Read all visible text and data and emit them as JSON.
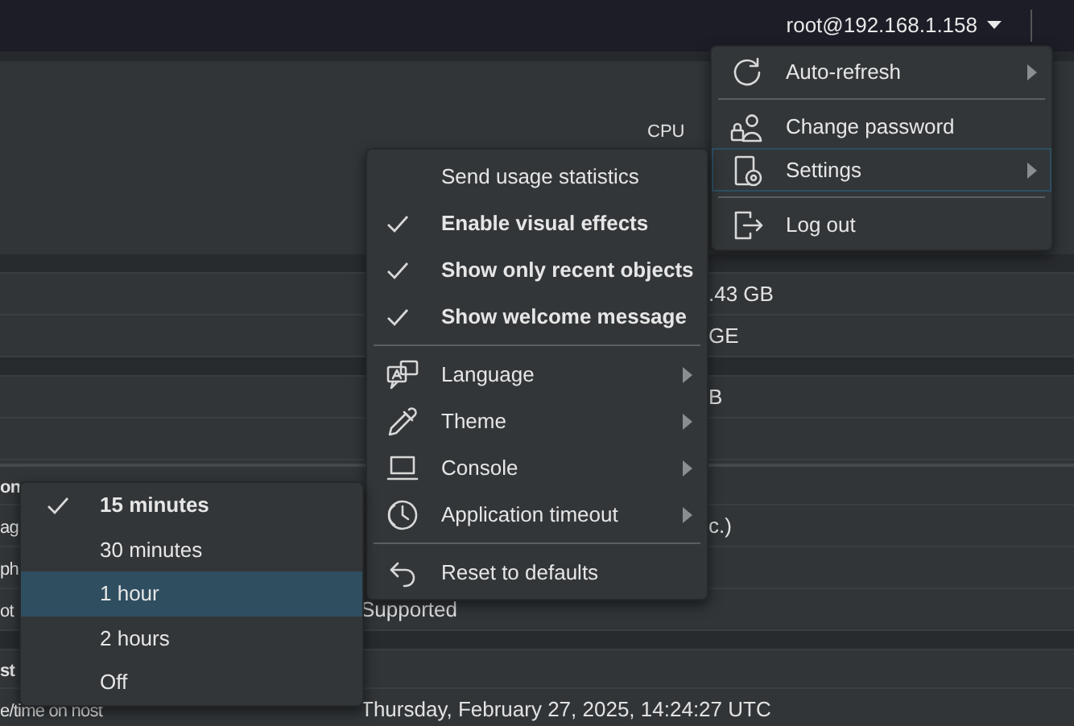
{
  "top_bar": {
    "user": "root@192.168.1.158"
  },
  "background": {
    "cpu_label": "CPU",
    "upper_rows": [
      {
        "kind": "band"
      },
      {
        "kind": "row",
        "column_3": ".43 GB"
      },
      {
        "kind": "row",
        "column_3": "GE"
      },
      {
        "kind": "band"
      },
      {
        "kind": "row",
        "column_3": "B"
      },
      {
        "kind": "row"
      }
    ],
    "lower_rows": [
      {
        "kind": "header",
        "column_1": "on"
      },
      {
        "kind": "row",
        "column_1": "ag",
        "column_3": "c.)"
      },
      {
        "kind": "row",
        "column_1": "ph"
      },
      {
        "kind": "row",
        "column_1": "ot",
        "column_2": "Supported"
      },
      {
        "kind": "band"
      },
      {
        "kind": "header",
        "column_1": "st"
      },
      {
        "kind": "row",
        "column_1": "e/time on host",
        "column_2": "Thursday, February 27, 2025, 14:24:27 UTC"
      }
    ]
  },
  "user_menu": [
    {
      "kind": "item",
      "label": "Auto-refresh",
      "submenu": true,
      "selected": false
    },
    {
      "kind": "divider"
    },
    {
      "kind": "item",
      "label": "Change password",
      "submenu": false,
      "selected": false
    },
    {
      "kind": "item",
      "label": "Settings",
      "submenu": true,
      "selected": true
    },
    {
      "kind": "divider"
    },
    {
      "kind": "item",
      "label": "Log out",
      "submenu": false,
      "selected": false
    }
  ],
  "settings_menu": [
    {
      "kind": "check",
      "label": "Send usage statistics",
      "checked": false
    },
    {
      "kind": "check",
      "label": "Enable visual effects",
      "checked": true
    },
    {
      "kind": "check",
      "label": "Show only recent objects",
      "checked": true
    },
    {
      "kind": "check",
      "label": "Show welcome message",
      "checked": true
    },
    {
      "kind": "divider"
    },
    {
      "kind": "item",
      "label": "Language",
      "submenu": true
    },
    {
      "kind": "item",
      "label": "Theme",
      "submenu": true
    },
    {
      "kind": "item",
      "label": "Console",
      "submenu": true
    },
    {
      "kind": "item",
      "label": "Application timeout",
      "submenu": true
    },
    {
      "kind": "divider"
    },
    {
      "kind": "item",
      "label": "Reset to defaults",
      "submenu": false
    }
  ],
  "timeout_menu": [
    {
      "label": "15 minutes",
      "checked": true,
      "selected": false
    },
    {
      "label": "30 minutes",
      "checked": false,
      "selected": false
    },
    {
      "label": "1 hour",
      "checked": false,
      "selected": true
    },
    {
      "label": "2 hours",
      "checked": false,
      "selected": false
    },
    {
      "label": "Off",
      "checked": false,
      "selected": false
    }
  ]
}
